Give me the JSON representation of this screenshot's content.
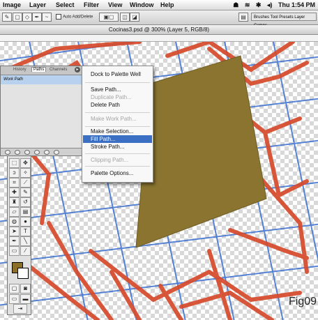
{
  "menubar": {
    "items": [
      "Image",
      "Layer",
      "Select",
      "Filter",
      "View",
      "Window",
      "Help"
    ],
    "clock": "Thu 1:54 PM"
  },
  "options_bar": {
    "auto_add_delete_label": "Auto Add/Delete",
    "palette_well_text": "Brushes Tool Presets Layer Comps"
  },
  "document": {
    "title": "Cocinas3.psd @ 300% (Layer 5, RGB/8)"
  },
  "paths_palette": {
    "tabs": [
      "History",
      "Paths",
      "Channels"
    ],
    "active_tab": "Paths",
    "work_path": "Work Path"
  },
  "context_menu": {
    "items": [
      {
        "label": "Dock to Palette Well",
        "enabled": true
      },
      {
        "label": "Save Path...",
        "enabled": true
      },
      {
        "label": "Duplicate Path...",
        "enabled": false
      },
      {
        "label": "Delete Path",
        "enabled": true
      },
      {
        "label": "Make Work Path...",
        "enabled": false
      },
      {
        "label": "Make Selection...",
        "enabled": true
      },
      {
        "label": "Fill Path...",
        "enabled": true,
        "highlighted": true
      },
      {
        "label": "Stroke Path...",
        "enabled": true
      },
      {
        "label": "Clipping Path...",
        "enabled": false
      },
      {
        "label": "Palette Options...",
        "enabled": true
      }
    ]
  },
  "colors": {
    "foreground": "#8c6f27",
    "background": "#ffffff",
    "fill_shape": "#8a7430",
    "guides": "#3a6fd0",
    "sketch_lines": "#d64a2b",
    "menu_highlight": "#3a6fc4"
  },
  "figure_label": "Fig09"
}
